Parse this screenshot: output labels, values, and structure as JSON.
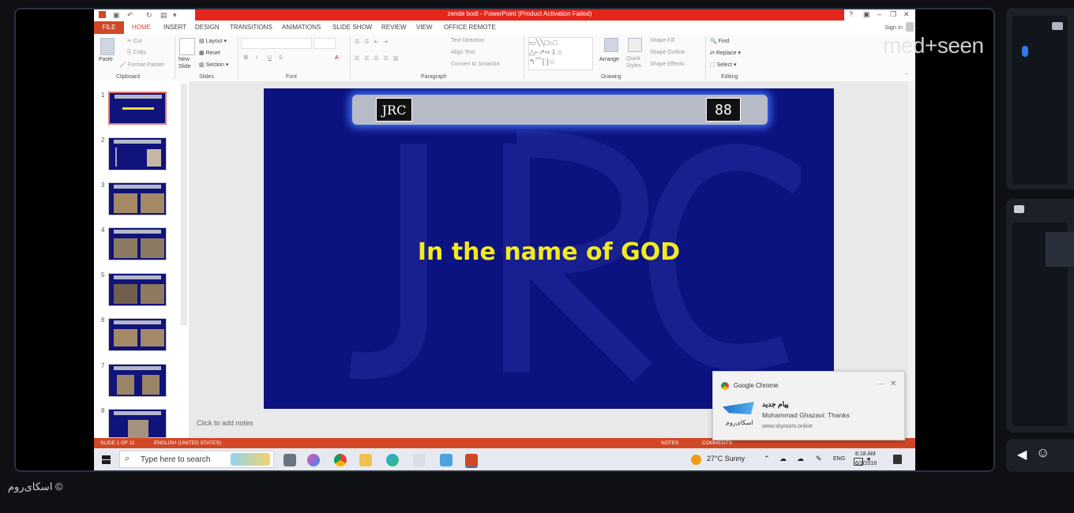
{
  "brand_overlay": "med+seen",
  "footer": {
    "brand": "اسکای‌روم ©"
  },
  "ppt": {
    "title": "zende bodi  -  PowerPoint (Product Activation Failed)",
    "signin": "Sign in",
    "tabs": [
      "FILE",
      "HOME",
      "INSERT",
      "DESIGN",
      "TRANSITIONS",
      "ANIMATIONS",
      "SLIDE SHOW",
      "REVIEW",
      "VIEW",
      "OFFICE REMOTE"
    ],
    "ribbon": {
      "clipboard": {
        "paste": "Paste",
        "cut": "Cut",
        "copy": "Copy",
        "format_painter": "Format Painter",
        "label": "Clipboard"
      },
      "slides": {
        "new_slide": "New Slide",
        "layout": "Layout",
        "reset": "Reset",
        "section": "Section",
        "label": "Slides"
      },
      "font": {
        "label": "Font",
        "buttons": [
          "B",
          "I",
          "U",
          "S"
        ]
      },
      "paragraph": {
        "label": "Paragraph",
        "text_direction": "Text Direction",
        "align_text": "Align Text",
        "convert": "Convert to SmartArt"
      },
      "drawing": {
        "arrange": "Arrange",
        "quick_styles": "Quick Styles",
        "shape_fill": "Shape Fill",
        "shape_outline": "Shape Outline",
        "shape_effects": "Shape Effects",
        "label": "Drawing"
      },
      "editing": {
        "find": "Find",
        "replace": "Replace",
        "select": "Select",
        "label": "Editing"
      }
    },
    "slide_numbers": [
      "1",
      "2",
      "3",
      "4",
      "5",
      "6",
      "7",
      "8"
    ],
    "slide": {
      "title": "In the name of GOD",
      "logo_left": "JRC",
      "logo_right": "88"
    },
    "notes_placeholder": "Click to add notes",
    "status": {
      "slide_info": "SLIDE 1 OF 11",
      "language": "ENGLISH (UNITED STATES)",
      "notes": "NOTES",
      "comments": "COMMENTS"
    }
  },
  "taskbar": {
    "search_placeholder": "Type here to search",
    "weather": "27°C  Sunny",
    "lang": "ENG",
    "time": "8:18 AM",
    "date": "6/3/2016"
  },
  "toast": {
    "app": "Google Chrome",
    "title": "پیام جدید",
    "message": "Mohammad Ghazavi: Thanks",
    "source": "www.skyroom.online",
    "logo_text": "اسکای‌روم"
  },
  "colors": {
    "ppt_accent": "#d24726",
    "title_bar_red": "#e5261c",
    "slide_bg": "#0c1380",
    "slide_title": "#f2ea21"
  }
}
